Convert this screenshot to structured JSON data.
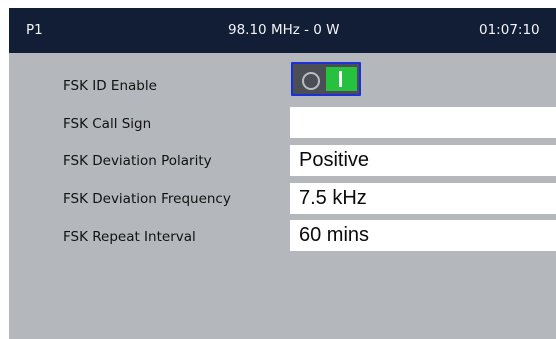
{
  "header": {
    "preset": "P1",
    "frequency_power": "98.10 MHz - 0 W",
    "time": "01:07:10"
  },
  "settings": [
    {
      "label": "FSK ID Enable",
      "type": "toggle",
      "value": "on"
    },
    {
      "label": "FSK Call Sign",
      "type": "text",
      "value": ""
    },
    {
      "label": "FSK Deviation Polarity",
      "type": "select",
      "value": "Positive"
    },
    {
      "label": "FSK Deviation Frequency",
      "type": "select",
      "value": "7.5 kHz"
    },
    {
      "label": "FSK Repeat Interval",
      "type": "select",
      "value": "60 mins"
    }
  ],
  "colors": {
    "header_bg": "#121e35",
    "panel_bg": "#b4b7bb",
    "toggle_on": "#27c140",
    "focus_border": "#1c30d8"
  },
  "icons": {
    "toggle_off_symbol": "circle-icon",
    "toggle_on_symbol": "bar-icon"
  }
}
